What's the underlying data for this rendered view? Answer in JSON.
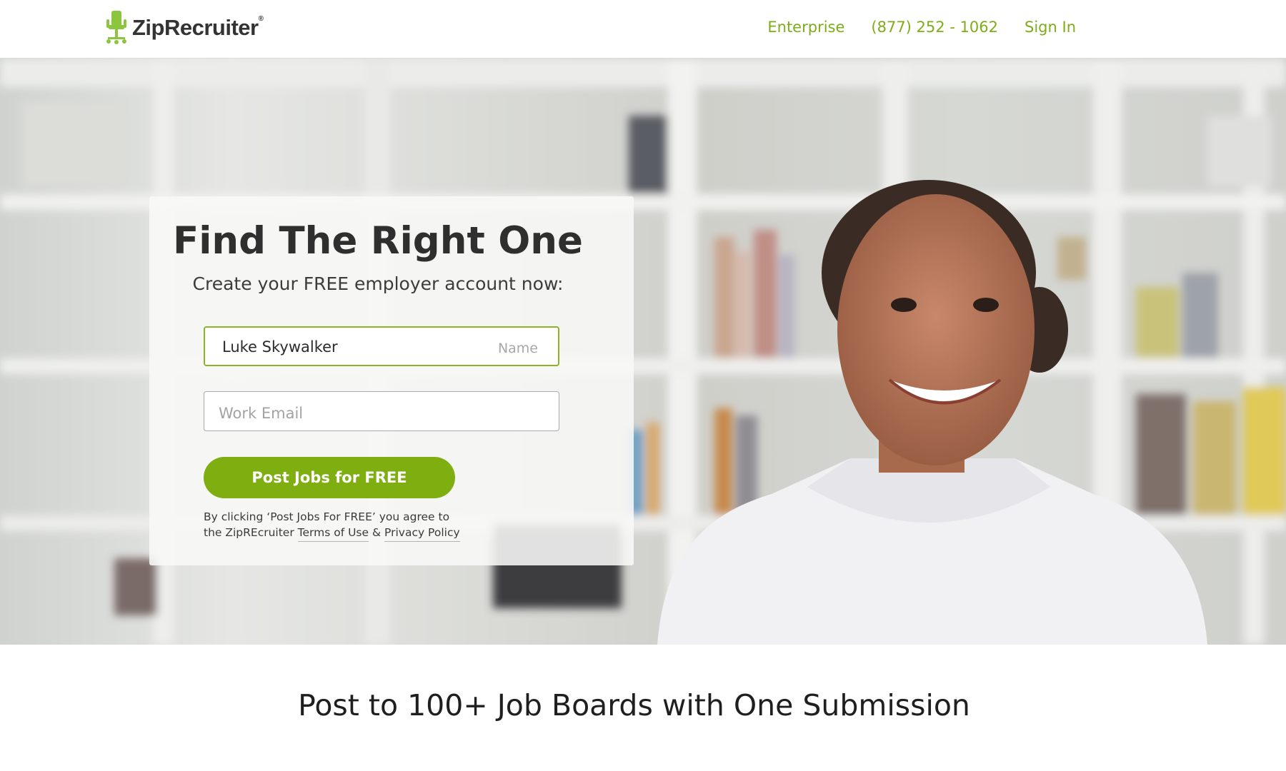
{
  "header": {
    "logo_text": "ZipRecruiter",
    "logo_reg": "®",
    "nav": {
      "enterprise": "Enterprise",
      "phone": "(877) 252 - 1062",
      "sign_in": "Sign In"
    }
  },
  "signup": {
    "title": "Find The Right One",
    "subtitle": "Create your FREE employer account now:",
    "name_field": {
      "value": "Luke Skywalker",
      "label": "Name"
    },
    "email_field": {
      "placeholder": "Work Email"
    },
    "submit_label": "Post Jobs for FREE",
    "legal": {
      "line1": "By clicking ‘Post Jobs For FREE’ you agree to",
      "prefix": "the ZipREcruiter",
      "terms": "Terms of Use",
      "amp": "&",
      "privacy": "Privacy Policy"
    }
  },
  "tagline": "Post to 100+ Job Boards with One Submission",
  "colors": {
    "brand_green": "#7fae10",
    "nav_green": "#7eac1a",
    "focus_border": "#8db327"
  },
  "icons": {
    "logo": "office-chair-icon"
  }
}
